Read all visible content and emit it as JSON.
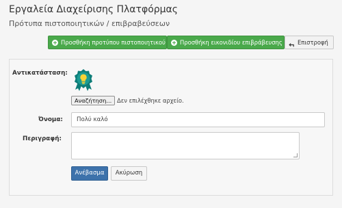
{
  "header": {
    "title": "Εργαλεία Διαχείρισης Πλατφόρμας",
    "subtitle": "Πρότυπα πιστοποιητικών / επιβραβεύσεων"
  },
  "toolbar": {
    "add_certificate_template": "Προσθήκη προτύπου πιστοποιητικού",
    "add_badge_icon": "Προσθήκη εικονιδίου επιβράβευσης",
    "back": "Επιστροφή"
  },
  "form": {
    "replacement_label": "Αντικατάσταση:",
    "browse_button": "Αναζήτηση...",
    "file_status": "Δεν επιλέχθηκε αρχείο.",
    "name_label": "Όνομα:",
    "name_value": "Πολύ καλό",
    "description_label": "Περιγραφή:",
    "description_value": "",
    "upload_button": "Ανέβασμα",
    "cancel_button": "Ακύρωση"
  },
  "icons": {
    "current_icon": "award-lightbulb-icon",
    "add_icons": "plus-circle-icon",
    "back_icon": "return-arrow-icon"
  },
  "colors": {
    "toolbar_green": "#4aa94b",
    "primary_blue": "#3d72ab",
    "award_teal": "#0d7d78",
    "award_yellow": "#f6d336"
  }
}
